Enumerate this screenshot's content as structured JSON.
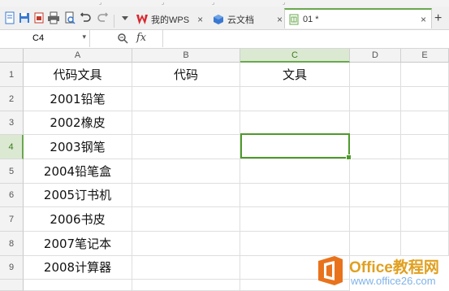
{
  "tabs": [
    {
      "label": "我的WPS",
      "close": "×"
    },
    {
      "label": "云文档",
      "close": "×"
    },
    {
      "label": "01 *",
      "close": "×"
    }
  ],
  "add_tab": "+",
  "name_box": {
    "value": "C4"
  },
  "formula": {
    "fx": "fx",
    "value": ""
  },
  "columns": [
    "A",
    "B",
    "C",
    "D",
    "E"
  ],
  "rows": [
    "1",
    "2",
    "3",
    "4",
    "5",
    "6",
    "7",
    "8",
    "9"
  ],
  "cells": {
    "A": [
      "代码文具",
      "2001铅笔",
      "2002橡皮",
      "2003钢笔",
      "2004铅笔盒",
      "2005订书机",
      "2006书皮",
      "2007笔记本",
      "2008计算器"
    ],
    "B": [
      "代码",
      "",
      "",
      "",
      "",
      "",
      "",
      "",
      ""
    ],
    "C": [
      "文具",
      "",
      "",
      "",
      "",
      "",
      "",
      "",
      ""
    ]
  },
  "selected_cell": "C4",
  "watermark": {
    "title": "Office教程网",
    "url": "www.office26.com"
  },
  "colors": {
    "accent": "#6aa84f",
    "wps_red": "#d9262e",
    "cloud_blue": "#3a79d0"
  }
}
